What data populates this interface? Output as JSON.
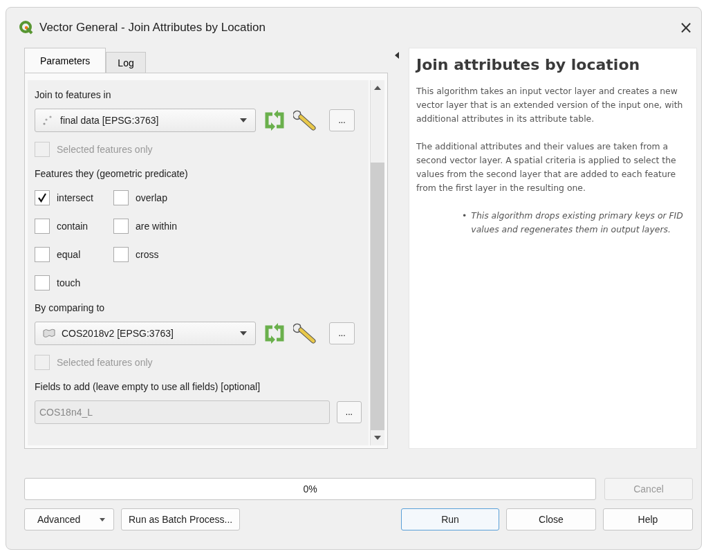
{
  "window": {
    "title": "Vector General - Join Attributes by Location",
    "close": "×"
  },
  "tabs": [
    {
      "label": "Parameters",
      "selected": true
    },
    {
      "label": "Log",
      "selected": false
    }
  ],
  "parameters": [
    {
      "kind": "label",
      "text": "Join to features in"
    },
    {
      "kind": "point_layer",
      "value": "final data [EPSG:3763]",
      "more": "..."
    },
    {
      "kind": "checkbox",
      "label": "Selected features only",
      "checked": false,
      "disabled": true
    },
    {
      "kind": "label",
      "text": "Features they (geometric predicate)"
    },
    {
      "kind": "predicates",
      "items": [
        {
          "label": "intersect",
          "checked": true
        },
        {
          "label": "overlap",
          "checked": false
        },
        {
          "label": "contain",
          "checked": false
        },
        {
          "label": "are within",
          "checked": false
        },
        {
          "label": "equal",
          "checked": false
        },
        {
          "label": "cross",
          "checked": false
        },
        {
          "label": "touch",
          "checked": false
        }
      ]
    },
    {
      "kind": "label",
      "text": "By comparing to"
    },
    {
      "kind": "polygon_layer",
      "value": "COS2018v2 [EPSG:3763]",
      "more": "..."
    },
    {
      "kind": "checkbox",
      "label": "Selected features only",
      "checked": false,
      "disabled": true
    },
    {
      "kind": "label",
      "text": "Fields to add (leave empty to use all fields) [optional]"
    },
    {
      "kind": "field",
      "value": "COS18n4_L",
      "disabled": true,
      "more": "..."
    }
  ],
  "help": {
    "title": "Join attributes by location",
    "paragraphs": [
      "This algorithm takes an input vector layer and creates a new vector layer that is an extended version of the input one, with additional attributes in its attribute table.",
      "The additional attributes and their values are taken from a second vector layer. A spatial criteria is applied to select the values from the second layer that are added to each feature from the first layer in the resulting one."
    ],
    "notes": [
      {
        "bullet": "•",
        "text": "This algorithm drops existing primary keys or FID values and regenerates them in output layers."
      }
    ]
  },
  "progress": {
    "level": 0,
    "text": "0%"
  },
  "cancel": {
    "label": "Cancel",
    "disabled": true
  },
  "buttons": [
    {
      "kind": "menu",
      "label": "Advanced",
      "default": false
    },
    {
      "kind": "plain",
      "label": "Run as Batch Process...",
      "default": false
    },
    {
      "kind": "spacer"
    },
    {
      "kind": "plain",
      "label": "Run",
      "default": true
    },
    {
      "kind": "plain",
      "label": "Close",
      "default": false
    },
    {
      "kind": "plain",
      "label": "Help",
      "default": false
    }
  ]
}
